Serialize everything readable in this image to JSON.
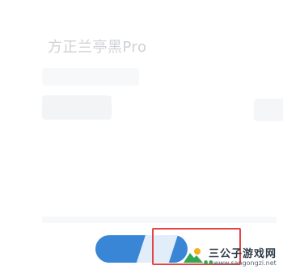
{
  "font": {
    "name": "方正兰亭黑Pro"
  },
  "watermark": {
    "site_name": "三公子游戏网",
    "url": "www.sangongzi.net",
    "logo_icon": "mountain-sun-icon",
    "accent_color": "#2fa84f"
  },
  "apply_button": {
    "color": "#3a86d6"
  },
  "highlight": {
    "color": "#e64545"
  }
}
